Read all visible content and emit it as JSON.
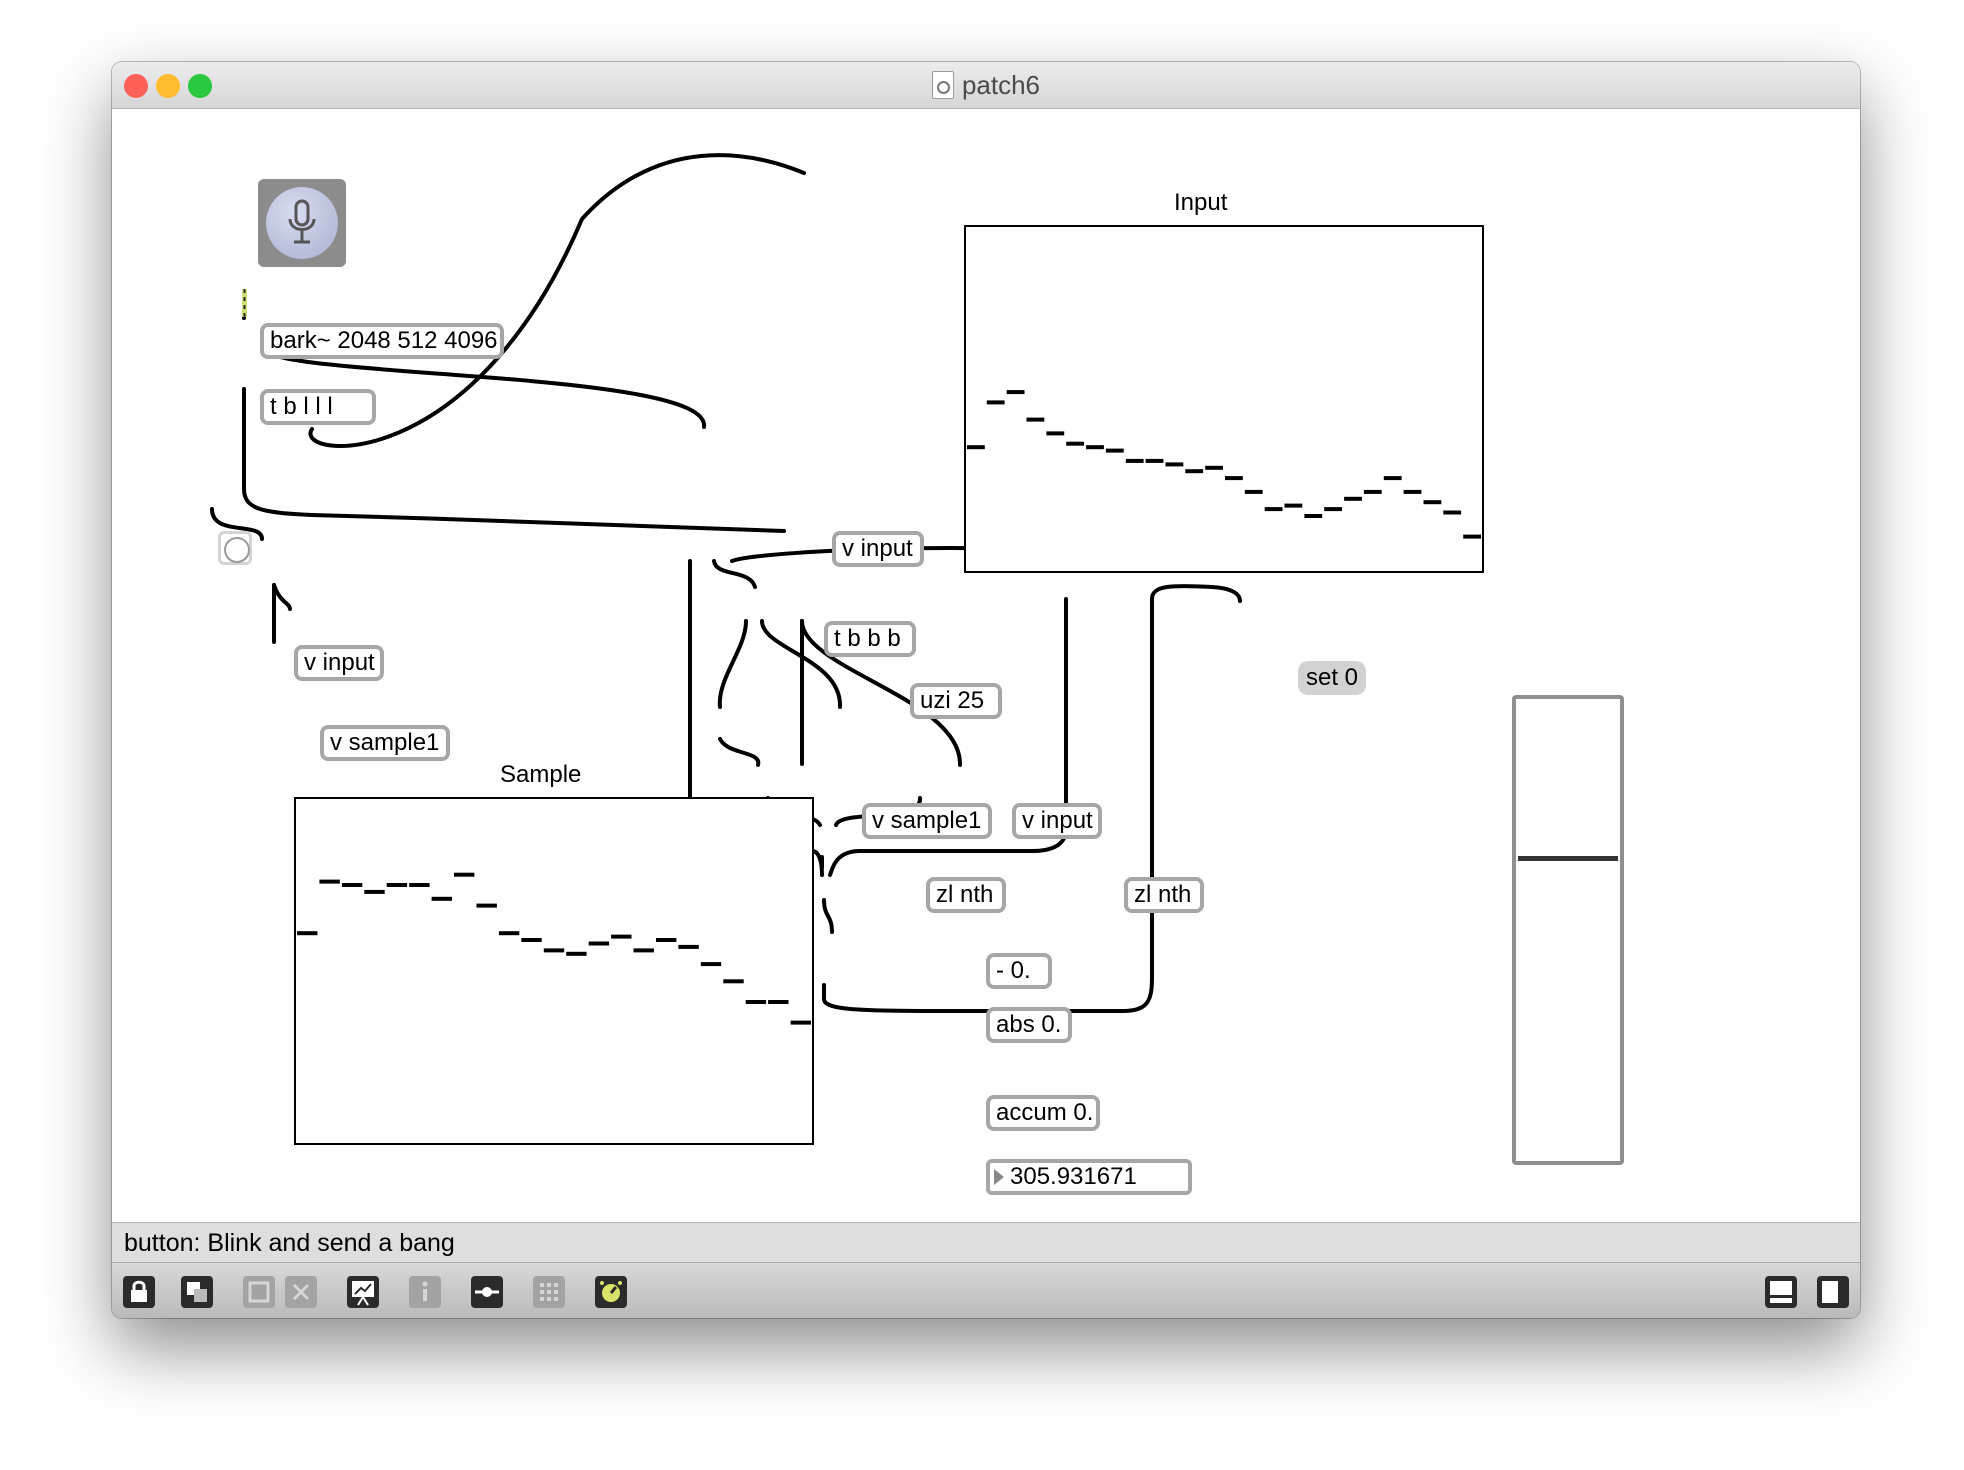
{
  "window": {
    "title": "patch6",
    "traffic_lights": {
      "close": "#fe5f57",
      "minimize": "#febc2e",
      "zoom": "#28c840"
    }
  },
  "patch": {
    "objects": {
      "bark": "bark~ 2048 512 4096",
      "trigger_blll": "t b l l l",
      "v_input_top": "v input",
      "v_input_left": "v input",
      "v_sample1_left": "v sample1",
      "trigger_bbb": "t b b b",
      "uzi": "uzi 25",
      "v_sample1_mid": "v sample1",
      "v_input_mid": "v input",
      "zl_nth_1": "zl nth",
      "zl_nth_2": "zl nth",
      "minus": "- 0.",
      "abs": "abs 0.",
      "accum": "accum 0."
    },
    "message_set0": "set 0",
    "number_box_value": "305.931671",
    "labels": {
      "input": "Input",
      "sample": "Sample"
    },
    "multislider_input_values": [
      0.36,
      0.49,
      0.52,
      0.44,
      0.4,
      0.37,
      0.36,
      0.35,
      0.32,
      0.32,
      0.31,
      0.29,
      0.3,
      0.27,
      0.23,
      0.18,
      0.19,
      0.16,
      0.18,
      0.21,
      0.23,
      0.27,
      0.23,
      0.2,
      0.17,
      0.1
    ],
    "multislider_sample_values": [
      0.61,
      0.76,
      0.75,
      0.73,
      0.75,
      0.75,
      0.71,
      0.78,
      0.69,
      0.61,
      0.59,
      0.56,
      0.55,
      0.58,
      0.6,
      0.56,
      0.59,
      0.57,
      0.52,
      0.47,
      0.41,
      0.41,
      0.35
    ],
    "vertical_slider_level": 0.66
  },
  "status_text": "button: Blink and send a bang",
  "toolbar": {
    "left_icons": [
      "lock-icon",
      "presentation-toggle-icon",
      "paste-disabled-icon",
      "delete-disabled-icon",
      "debug-icon",
      "inspector-icon",
      "object-palette-icon",
      "grid-icon",
      "dsp-icon"
    ],
    "right_icons": [
      "bottom-panel-icon",
      "right-panel-icon"
    ]
  }
}
